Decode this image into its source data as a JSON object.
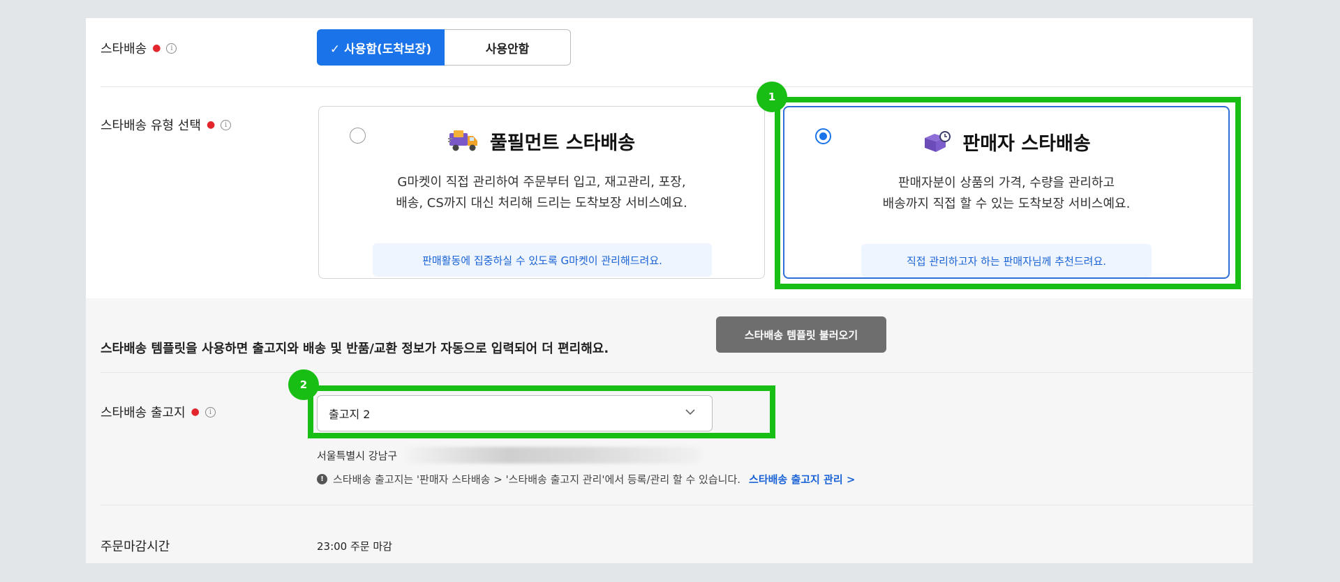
{
  "rows": {
    "star_delivery": {
      "label": "스타배송",
      "options": [
        "✓ 사용함(도착보장)",
        "사용안함"
      ],
      "selected": "✓ 사용함(도착보장)"
    },
    "type_select": {
      "label": "스타배송 유형 선택",
      "cards": [
        {
          "title": "풀필먼트 스타배송",
          "desc_line1": "G마켓이 직접 관리하여 주문부터 입고, 재고관리, 포장,",
          "desc_line2": "배송, CS까지 대신 처리해 드리는 도착보장 서비스예요.",
          "tip": "판매활동에 집중하실 수 있도록 G마켓이 관리해드려요.",
          "selected": false,
          "icon": "truck-icon"
        },
        {
          "title": "판매자 스타배송",
          "desc_line1": "판매자분이 상품의 가격, 수량을 관리하고",
          "desc_line2": "배송까지 직접 할 수 있는 도착보장 서비스예요.",
          "tip": "직접 관리하고자 하는 판매자님께 추천드려요.",
          "selected": true,
          "icon": "box-clock-icon"
        }
      ]
    },
    "template": {
      "text": "스타배송 템플릿을 사용하면 출고지와 배송 및 반품/교환 정보가 자동으로 입력되어 더 편리해요.",
      "button": "스타배송 템플릿 불러오기"
    },
    "warehouse": {
      "label": "스타배송 출고지",
      "select_value": "출고지 2",
      "address": "서울특별시 강남구",
      "notice": "스타배송 출고지는 '판매자 스타배송 > '스타배송 출고지 관리'에서 등록/관리 할 수 있습니다.",
      "notice_link": "스타배송 출고지 관리 >"
    },
    "deadline": {
      "label": "주문마감시간",
      "value": "23:00 주문 마감"
    }
  },
  "annotations": {
    "badge1": "1",
    "badge2": "2"
  },
  "colors": {
    "accent": "#1a73e8",
    "highlight": "#19be14",
    "required": "#e3262d",
    "tip_bg": "#eef5fe",
    "template_button": "#6e6e6e"
  }
}
